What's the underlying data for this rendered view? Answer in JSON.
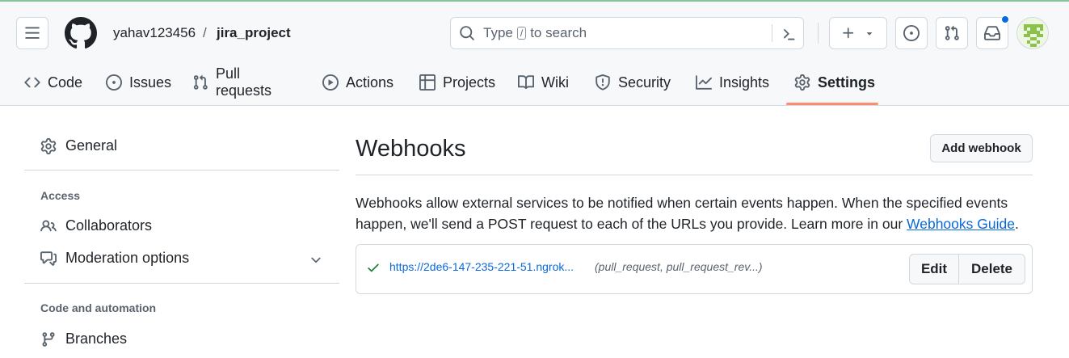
{
  "header": {
    "owner": "yahav123456",
    "separator": "/",
    "repo": "jira_project",
    "search": {
      "before": "Type",
      "key": "/",
      "after": "to search"
    }
  },
  "nav": {
    "tabs": [
      {
        "label": "Code",
        "icon": "code-icon"
      },
      {
        "label": "Issues",
        "icon": "issue-opened-icon"
      },
      {
        "label": "Pull requests",
        "icon": "git-pull-request-icon"
      },
      {
        "label": "Actions",
        "icon": "play-icon"
      },
      {
        "label": "Projects",
        "icon": "table-icon"
      },
      {
        "label": "Wiki",
        "icon": "book-icon"
      },
      {
        "label": "Security",
        "icon": "shield-icon"
      },
      {
        "label": "Insights",
        "icon": "graph-icon"
      },
      {
        "label": "Settings",
        "icon": "gear-icon",
        "active": true
      }
    ]
  },
  "sidebar": {
    "general": "General",
    "access_heading": "Access",
    "collaborators": "Collaborators",
    "moderation": "Moderation options",
    "code_heading": "Code and automation",
    "branches": "Branches"
  },
  "main": {
    "title": "Webhooks",
    "add_button": "Add webhook",
    "description": "Webhooks allow external services to be notified when certain events happen. When the specified events happen, we'll send a POST request to each of the URLs you provide. Learn more in our ",
    "guide_link": "Webhooks Guide",
    "description_end": ".",
    "webhook": {
      "status": "check-icon",
      "url": "https://2de6-147-235-221-51.ngrok...",
      "events": "(pull_request, pull_request_rev...)",
      "edit": "Edit",
      "delete": "Delete"
    }
  },
  "colors": {
    "accent": "#0969da",
    "success": "#1a7f37",
    "tab_underline": "#fd8c73",
    "notification": "#0969da"
  }
}
